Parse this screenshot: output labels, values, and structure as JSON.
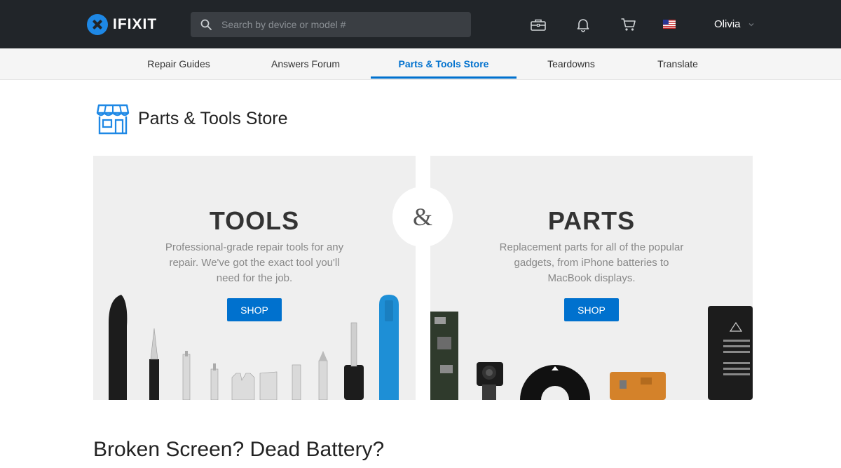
{
  "header": {
    "logo_text": "IFIXIT",
    "search": {
      "placeholder": "Search by device or model #",
      "value": ""
    },
    "icons": [
      "toolbox-icon",
      "bell-icon",
      "cart-icon",
      "us-flag-icon"
    ],
    "user_name": "Olivia"
  },
  "nav": {
    "items": [
      {
        "label": "Repair Guides",
        "active": false
      },
      {
        "label": "Answers Forum",
        "active": false
      },
      {
        "label": "Parts & Tools Store",
        "active": true
      },
      {
        "label": "Teardowns",
        "active": false
      },
      {
        "label": "Translate",
        "active": false
      }
    ]
  },
  "page": {
    "title": "Parts & Tools Store",
    "icon": "storefront-icon"
  },
  "panels": {
    "tools": {
      "heading": "TOOLS",
      "description": "Professional-grade repair tools for any repair. We've got the exact tool you'll need for the job.",
      "button": "SHOP"
    },
    "parts": {
      "heading": "PARTS",
      "description": "Replacement parts for all of the popular gadgets, from iPhone batteries to MacBook displays.",
      "button": "SHOP"
    },
    "connector": "&"
  },
  "section": {
    "heading": "Broken Screen? Dead Battery?"
  },
  "colors": {
    "header_bg": "#212529",
    "accent": "#0071ce",
    "logo_blue": "#1e88e5",
    "panel_bg": "#efefef"
  }
}
